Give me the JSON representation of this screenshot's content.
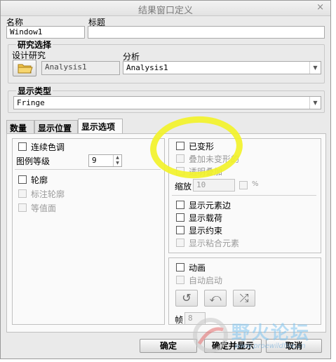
{
  "window": {
    "title": "结果窗口定义",
    "close_glyph": "×"
  },
  "name_field": {
    "label": "名称",
    "value": "Window1"
  },
  "title_field": {
    "label": "标题",
    "value": ""
  },
  "study_group": {
    "title": "研究选择",
    "design_study_label": "设计研究",
    "design_study_value": "Analysis1",
    "analysis_label": "分析",
    "analysis_value": "Analysis1"
  },
  "display_type_group": {
    "title": "显示类型",
    "value": "Fringe"
  },
  "tabs": [
    {
      "label": "数量"
    },
    {
      "label": "显示位置"
    },
    {
      "label": "显示选项"
    }
  ],
  "left_panel": {
    "continuous_tone": "连续色调",
    "legend_levels_label": "图例等级",
    "legend_levels_value": "9",
    "contour": "轮廓",
    "label_contour": "标注轮廓",
    "isosurface": "等值面"
  },
  "right_panel": {
    "deformed": "已变形",
    "overlay_undeformed": "叠加未变形的",
    "transparent_overlay": "透明叠加",
    "scale_label": "缩放",
    "scale_value": "10",
    "percent": "%",
    "show_element_edges": "显示元素边",
    "show_loads": "显示载荷",
    "show_constraints": "显示约束",
    "show_bonded_elements": "显示粘合元素"
  },
  "animation_panel": {
    "animate": "动画",
    "auto_start": "自动启动",
    "frames_label": "帧",
    "frames_value": "8"
  },
  "buttons": {
    "ok": "确定",
    "ok_and_show": "确定并显示",
    "cancel": "取消"
  },
  "watermark": {
    "text": "野火论坛",
    "url": "www.proewildfire.cn"
  },
  "colors": {
    "highlight": "#f2f22a",
    "window_bg": "#eaeaea",
    "panel_bg": "#fafafa"
  }
}
